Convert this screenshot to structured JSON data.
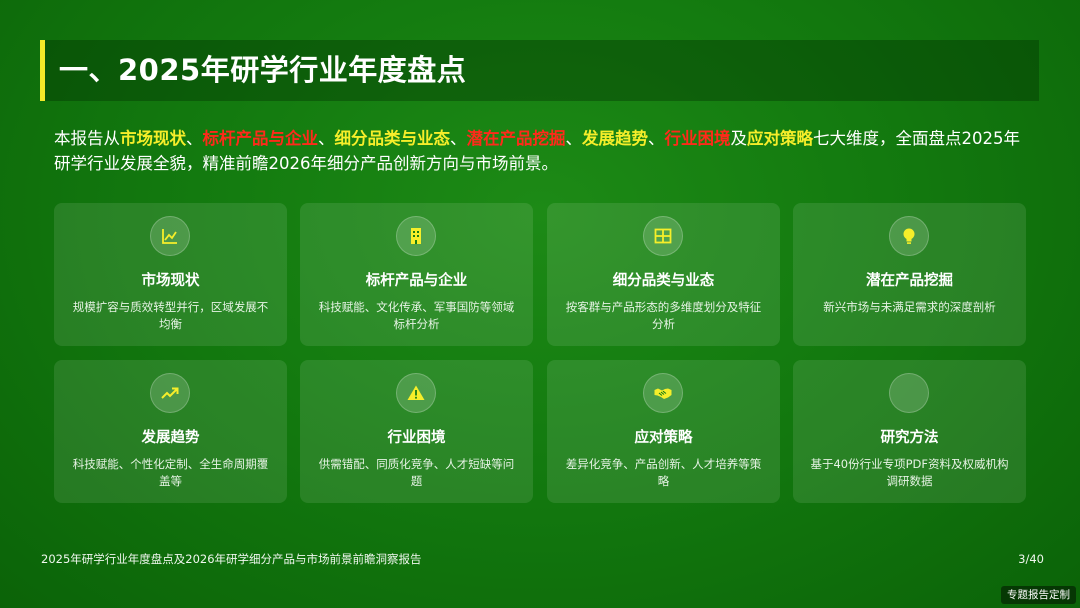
{
  "slide": {
    "title": "一、2025年研学行业年度盘点",
    "intro": [
      {
        "text": "本报告从",
        "style": "plain"
      },
      {
        "text": "市场现状",
        "style": "yellow"
      },
      {
        "text": "、",
        "style": "plain"
      },
      {
        "text": "标杆产品与企业",
        "style": "red"
      },
      {
        "text": "、",
        "style": "plain"
      },
      {
        "text": "细分品类与业态",
        "style": "yellow"
      },
      {
        "text": "、",
        "style": "plain"
      },
      {
        "text": "潜在产品挖掘",
        "style": "red"
      },
      {
        "text": "、",
        "style": "plain"
      },
      {
        "text": "发展趋势",
        "style": "yellow"
      },
      {
        "text": "、",
        "style": "plain"
      },
      {
        "text": "行业困境",
        "style": "red"
      },
      {
        "text": "及",
        "style": "plain"
      },
      {
        "text": "应对策略",
        "style": "yellow"
      },
      {
        "text": "七大维度，全面盘点2025年研学行业发展全貌，精准前瞻2026年细分产品创新方向与市场前景。",
        "style": "plain"
      }
    ],
    "cards": [
      {
        "title": "市场现状",
        "desc": "规模扩容与质效转型并行，区域发展不均衡",
        "icon": "chart-line-icon"
      },
      {
        "title": "标杆产品与企业",
        "desc": "科技赋能、文化传承、军事国防等领域标杆分析",
        "icon": "building-icon"
      },
      {
        "title": "细分品类与业态",
        "desc": "按客群与产品形态的多维度划分及特征分析",
        "icon": "grid-icon"
      },
      {
        "title": "潜在产品挖掘",
        "desc": "新兴市场与未满足需求的深度剖析",
        "icon": "lightbulb-icon"
      },
      {
        "title": "发展趋势",
        "desc": "科技赋能、个性化定制、全生命周期覆盖等",
        "icon": "trend-up-icon"
      },
      {
        "title": "行业困境",
        "desc": "供需错配、同质化竞争、人才短缺等问题",
        "icon": "warning-icon"
      },
      {
        "title": "应对策略",
        "desc": "差异化竞争、产品创新、人才培养等策略",
        "icon": "handshake-icon"
      },
      {
        "title": "研究方法",
        "desc": "基于40份行业专项PDF资料及权威机构调研数据",
        "icon": "blank-icon"
      }
    ],
    "footer": {
      "left": "2025年研学行业年度盘点及2026年研学细分产品与市场前景前瞻洞察报告",
      "page": "3/40"
    },
    "watermark": "专题报告定制"
  },
  "colors": {
    "highlight_yellow": "#f6ee2a",
    "highlight_red": "#ff2a1a",
    "accent_bar": "#f2ea28"
  }
}
